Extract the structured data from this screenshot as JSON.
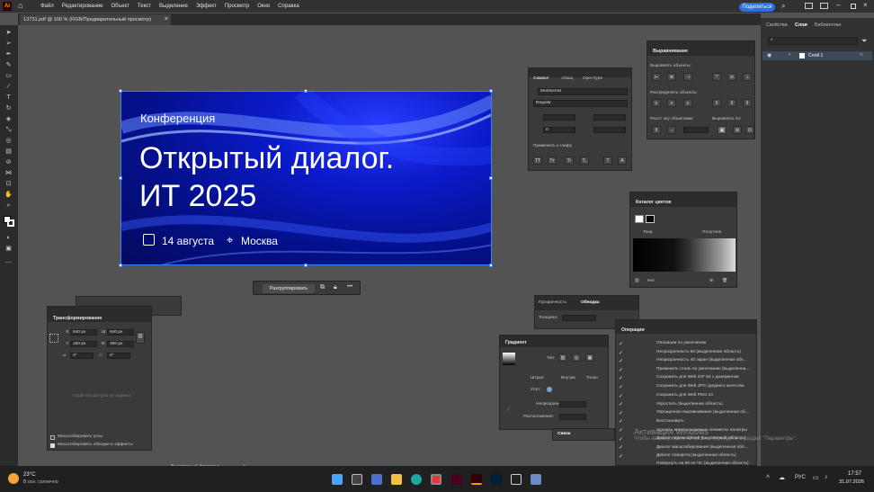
{
  "app": {
    "logo": "Ai",
    "share_label": "Поделиться"
  },
  "menu": [
    "Файл",
    "Редактирование",
    "Объект",
    "Текст",
    "Выделение",
    "Эффект",
    "Просмотр",
    "Окно",
    "Справка"
  ],
  "document_tab": "13731.pdf @ 100 % (RGB/Предварительный просмотр)",
  "dock_tabs": [
    "Свойства",
    "Слои",
    "Библиотеки"
  ],
  "layers": {
    "layer_name": "Слой 1"
  },
  "artboard": {
    "kicker": "Конференция",
    "title_line1": "Открытый диалог.",
    "title_line2": "ИТ 2025",
    "date": "14 августа",
    "city": "Москва",
    "accent": "#0a1ac9"
  },
  "context_bar": {
    "ungroup_label": "Разгруппировать",
    "more": "•••"
  },
  "symbol_panel": {
    "tabs": [
      "Символ",
      "Абзац",
      "OpenType"
    ],
    "font": "Montserrat",
    "style": "Regular",
    "tracking": "0",
    "apply_label": "Применить к глифу"
  },
  "align_panel": {
    "title": "Выравнивание",
    "align_objects": "Выровнять объекты:",
    "distribute_objects": "Распределить объекты:",
    "distribute_spacing": "Расст. м/у объектами:",
    "align_to": "Выровнять по:"
  },
  "swatch_panel": {
    "title": "Каталог цветов",
    "tone": "Тона",
    "halftone": "Полутона",
    "none": "Нет"
  },
  "transparency_panel": {
    "tabs": [
      "Прозрачность",
      "Обводка"
    ],
    "thickness_label": "Толщина:"
  },
  "gradient_panel": {
    "title": "Градиент",
    "type_label": "Тип:",
    "stroke_label": "Штрих:",
    "angle_label": "Угол:",
    "opacity_label": "Непрозрачность:",
    "location_label": "Расположение:",
    "stroke_opts": [
      "Внутри",
      "Тонко",
      "Тонко"
    ]
  },
  "transform_panel": {
    "title": "Трансформирование",
    "x_value": "640 рх",
    "w_value": "640 рх",
    "y_value": "150 рх",
    "h_value": "300 рх",
    "angle_value": "0°",
    "shear_value": "0°",
    "placeholder": "Свойства фигуры не заданы",
    "scale_corners": "Масштабировать углы",
    "scale_strokes": "Масштабировать обводки и эффекты"
  },
  "links_panel": {
    "title": "Связи"
  },
  "operations_panel": {
    "title": "Операции",
    "rows": [
      "Операции по умолчанию",
      "Непрозрачность 60 (выделенная область)",
      "Непрозрачность 40 экран (выделенная обл...",
      "Применить стиль по умолчанию (выделенна...",
      "Сохранить для Web GIF 64 с дизерингом",
      "Сохранить для Web JPG среднего качества",
      "Сохранить для Web PNG 24",
      "Упростить (выделенная область)",
      "Упрощенное выравнивание (выделенная об...",
      "Восстановить",
      "Удалить неиспользуемые элементы палитры",
      "Диалог перемещения (выделенная область)",
      "Диалог масштабирования (выделенная обл...",
      "Диалог поворота (выделенная область)",
      "Повернуть на 90 по ЧС (выделенная область)"
    ]
  },
  "status_bar": {
    "selection": "Выделенный фрагмент"
  },
  "watermark": {
    "line1": "Активация Windows",
    "line2": "Чтобы активировать Windows, перейдите в раздел \"Параметры\"."
  },
  "taskbar": {
    "weather_temp": "23°C",
    "weather_desc": "В осн. солнечно",
    "lang": "РУС",
    "time": "17:57",
    "date": "31.07.2026"
  }
}
